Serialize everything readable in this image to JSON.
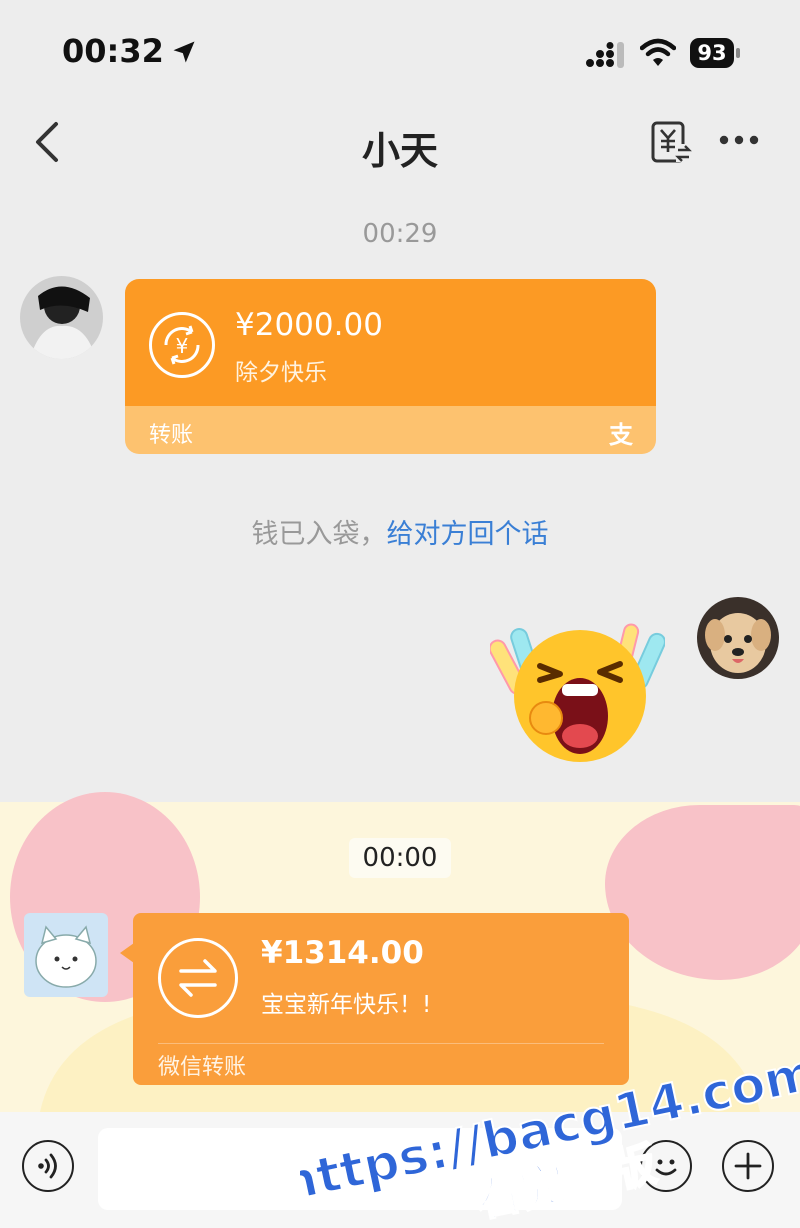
{
  "status_bar": {
    "time": "00:32",
    "battery": "93"
  },
  "header": {
    "title": "小天"
  },
  "messages": {
    "timestamp_1": "00:29",
    "alipay_transfer": {
      "amount": "¥2000.00",
      "note": "除夕快乐",
      "label": "转账",
      "brand_glyph": "支"
    },
    "system_notice": {
      "text": "钱已入袋，",
      "link": "给对方回个话"
    },
    "timestamp_2": "00:00",
    "wechat_transfer": {
      "amount": "¥1314.00",
      "note": "宝宝新年快乐！!",
      "label": "微信转账"
    }
  },
  "watermark": {
    "line1": "https://bacg14.com",
    "line2": "看完整版"
  },
  "colors": {
    "alipay_orange": "#fc9a24",
    "wechat_transfer_orange": "#fa9e3b",
    "link_blue": "#3a7fd5"
  },
  "icons": [
    "location-arrow-icon",
    "signal-icon",
    "wifi-icon",
    "battery-icon",
    "back-chevron-icon",
    "money-transfer-icon",
    "more-icon",
    "yuan-coin-icon",
    "transfer-arrows-icon",
    "voice-icon",
    "emoji-icon",
    "plus-icon"
  ]
}
